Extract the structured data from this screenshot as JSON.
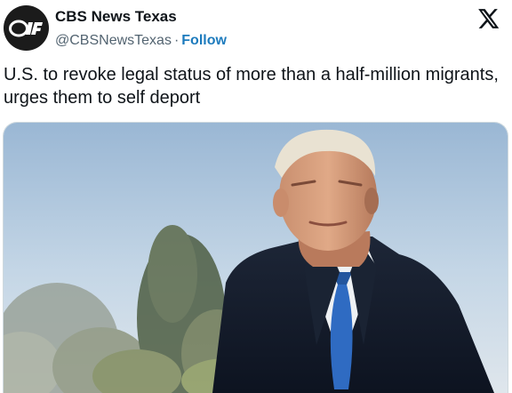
{
  "account": {
    "display_name": "CBS News Texas",
    "handle": "@CBSNewsTexas",
    "separator": "·",
    "follow_label": "Follow",
    "avatar_logo": "tv-network-logo",
    "avatar_bg": "#1b1b1b"
  },
  "brand": {
    "icon": "x-logo-icon"
  },
  "tweet": {
    "text": "U.S. to revoke legal status of more than a half-million migrants, urges them to self deport"
  },
  "media": {
    "type": "photo",
    "subject": "man-in-suit-outdoors"
  },
  "colors": {
    "text": "#0f1419",
    "secondary": "#536471",
    "follow": "#1d7bbd",
    "border": "#cfd9de"
  }
}
